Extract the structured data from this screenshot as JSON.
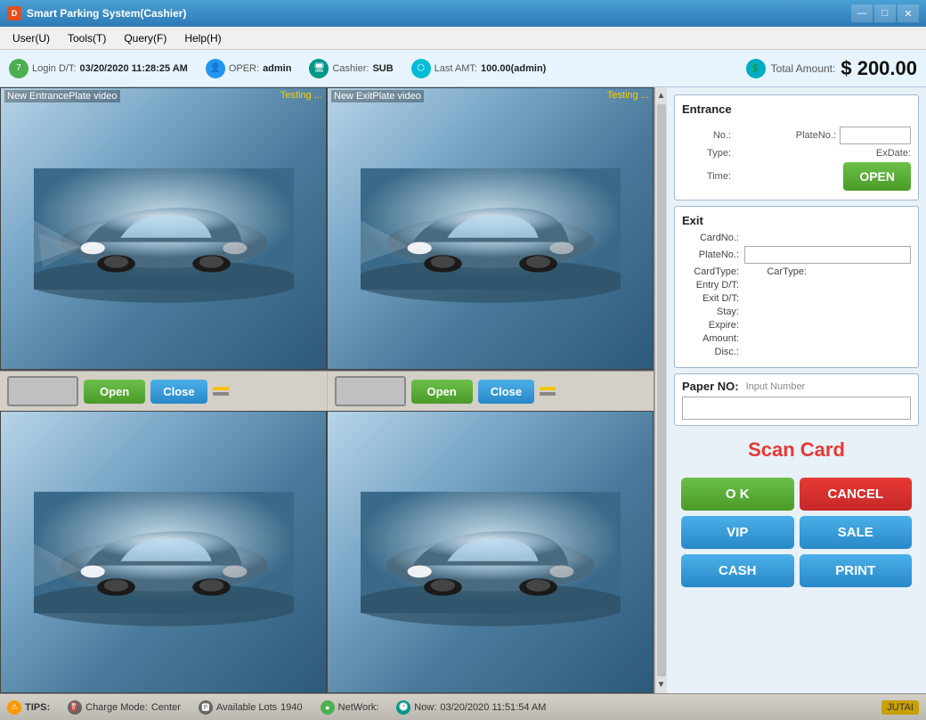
{
  "titleBar": {
    "title": "Smart Parking System(Cashier)",
    "icon": "D",
    "buttons": [
      "—",
      "□",
      "✕"
    ]
  },
  "menuBar": {
    "items": [
      "User(U)",
      "Tools(T)",
      "Query(F)",
      "Help(H)"
    ]
  },
  "infoBar": {
    "login": {
      "label": "Login D/T:",
      "value": "03/20/2020 11:28:25 AM",
      "iconNum": "7"
    },
    "oper": {
      "label": "OPER:",
      "value": "admin"
    },
    "cashier": {
      "label": "Cashier:",
      "value": "SUB"
    },
    "lastAmt": {
      "label": "Last AMT:",
      "value": "100.00(admin)"
    },
    "total": {
      "label": "Total Amount:",
      "value": "$ 200.00"
    }
  },
  "videoFeeds": {
    "entrance": {
      "label": "New EntrancePlate video",
      "status": "Testing ..."
    },
    "exit": {
      "label": "New ExitPlate video",
      "status": "Testing ..."
    }
  },
  "controls": {
    "openLabel": "Open",
    "closeLabel": "Close"
  },
  "entrance": {
    "title": "Entrance",
    "noLabel": "No.:",
    "plateNoLabel": "PlateNo.:",
    "typeLabel": "Type:",
    "exDateLabel": "ExDate:",
    "timeLabel": "Time:",
    "openBtn": "OPEN"
  },
  "exit": {
    "title": "Exit",
    "cardNoLabel": "CardNo.:",
    "plateNoLabel": "PlateNo.:",
    "cardTypeLabel": "CardType:",
    "carTypeLabel": "CarType:",
    "entryDTLabel": "Entry D/T:",
    "exitDTLabel": "Exit D/T:",
    "stayLabel": "Stay:",
    "expireLabel": "Expire:",
    "amountLabel": "Amount:",
    "discLabel": "Disc.:"
  },
  "paperNo": {
    "label": "Paper NO:",
    "hint": "Input Number"
  },
  "scanCard": {
    "label": "Scan Card"
  },
  "buttons": {
    "ok": "O K",
    "cancel": "CANCEL",
    "vip": "VIP",
    "sale": "SALE",
    "cash": "CASH",
    "print": "PRINT"
  },
  "statusBar": {
    "tips": "TIPS:",
    "chargeMode": {
      "label": "Charge Mode:",
      "value": "Center"
    },
    "availableLots": {
      "label": "Available Lots",
      "value": "1940"
    },
    "network": {
      "label": "NetWork:",
      "value": ""
    },
    "now": {
      "label": "Now:",
      "value": "03/20/2020 11:51:54 AM"
    },
    "jutai": "JUTAI"
  }
}
